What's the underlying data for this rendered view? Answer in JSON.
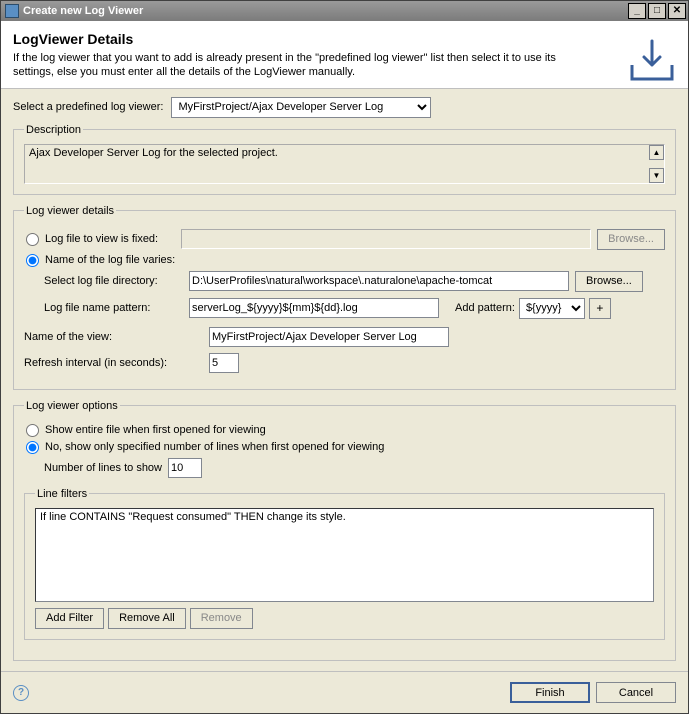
{
  "window": {
    "title": "Create new Log Viewer"
  },
  "header": {
    "title": "LogViewer Details",
    "subtitle": "If the log viewer that you want to add is already present in the \"predefined log viewer\" list then select it to use its settings, else you must enter all the details of the LogViewer manually."
  },
  "predefined": {
    "label": "Select a predefined log viewer:",
    "value": "MyFirstProject/Ajax Developer Server Log"
  },
  "description": {
    "legend": "Description",
    "text": "Ajax Developer Server Log for the selected project."
  },
  "details": {
    "legend": "Log viewer details",
    "radio_fixed": "Log file to view is fixed:",
    "browse_btn": "Browse...",
    "radio_varies": "Name of the log file varies:",
    "dir_label": "Select log file directory:",
    "dir_value": "D:\\UserProfiles\\natural\\workspace\\.naturalone\\apache-tomcat",
    "pattern_label": "Log file name pattern:",
    "pattern_value": "serverLog_${yyyy}${mm}${dd}.log",
    "add_pattern_label": "Add pattern:",
    "add_pattern_value": "${yyyy}",
    "plus_btn": "+",
    "view_name_label": "Name of the view:",
    "view_name_value": "MyFirstProject/Ajax Developer Server Log",
    "refresh_label": "Refresh interval (in seconds):",
    "refresh_value": "5"
  },
  "options": {
    "legend": "Log viewer options",
    "radio_entire": "Show entire file when first opened for viewing",
    "radio_partial": "No, show only specified number of lines when first opened for viewing",
    "lines_label": "Number of lines to show",
    "lines_value": "10"
  },
  "filters": {
    "legend": "Line filters",
    "item1": "If line CONTAINS \"Request consumed\" THEN change its style.",
    "add_btn": "Add Filter",
    "remove_all_btn": "Remove All",
    "remove_btn": "Remove"
  },
  "footer": {
    "finish": "Finish",
    "cancel": "Cancel"
  }
}
